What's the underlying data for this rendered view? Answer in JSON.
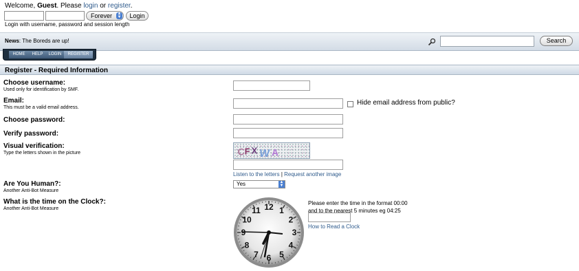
{
  "header": {
    "welcome_prefix": "Welcome, ",
    "guest": "Guest",
    "please": ". Please ",
    "login_link": "login",
    "or": " or ",
    "register_link": "register",
    "period": ".",
    "session_length": "Forever",
    "login_button": "Login",
    "login_hint": "Login with username, password and session length"
  },
  "news": {
    "label": "News",
    "text": ": The Boreds are up!"
  },
  "search": {
    "button": "Search",
    "icon": "magnifier-icon"
  },
  "menu": {
    "tabs": [
      {
        "label": "HOME"
      },
      {
        "label": "HELP"
      },
      {
        "label": "LOGIN"
      },
      {
        "label": "REGISTER",
        "active": true
      }
    ]
  },
  "form": {
    "header": "Register - Required Information",
    "username": {
      "label": "Choose username:",
      "hint": "Used only for identification by SMF."
    },
    "email": {
      "label": "Email:",
      "hint": "This must be a valid email address.",
      "hide_label": "Hide email address from public?"
    },
    "password": {
      "label": "Choose password:"
    },
    "verify": {
      "label": "Verify password:"
    },
    "captcha": {
      "label": "Visual verification:",
      "hint": "Type the letters shown in the picture",
      "letters": "CFXWA",
      "listen": "Listen to the letters",
      "separator": " | ",
      "request": "Request another image"
    },
    "human": {
      "label": "Are You Human?:",
      "hint": "Another Anti-Bot Measure",
      "value": "Yes"
    },
    "clock": {
      "label": "What is the time on the Clock?:",
      "hint": "Another Anti-Bot Measure",
      "instruction_1": "Please enter the time in the format 00:00",
      "instruction_2": "and to the nearest 5 minutes eg 04:25",
      "help_link": "How to Read a Clock",
      "numerals": [
        "12",
        "1",
        "2",
        "3",
        "4",
        "5",
        "6",
        "7",
        "8",
        "9",
        "10",
        "11"
      ]
    }
  },
  "colors": {
    "link": "#2f5b8c",
    "menu_bg": "#1f3040",
    "bar_light": "#eef2f6",
    "bar_dark": "#cfdae6"
  }
}
